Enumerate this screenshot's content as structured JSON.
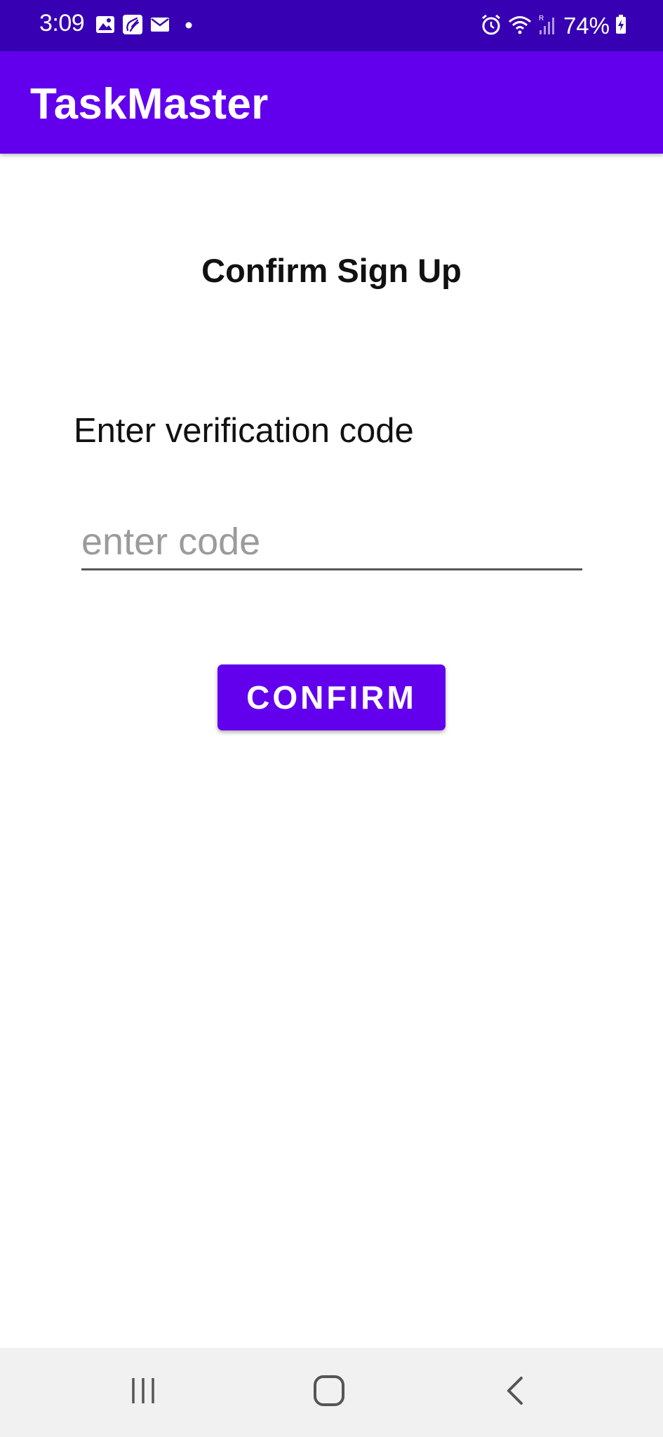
{
  "status_bar": {
    "time": "3:09",
    "battery_percent": "74%",
    "left_icons": [
      "gallery-icon",
      "sign-language-icon",
      "email-icon",
      "dot-icon"
    ],
    "right_icons": [
      "alarm-icon",
      "wifi-icon",
      "signal-icon",
      "battery-icon"
    ]
  },
  "app_bar": {
    "title": "TaskMaster"
  },
  "main": {
    "heading": "Confirm Sign Up",
    "field_label": "Enter verification code",
    "code_input": {
      "placeholder": "enter code",
      "value": ""
    },
    "confirm_label": "CONFIRM"
  },
  "nav_bar": {
    "buttons": [
      "recents-icon",
      "home-icon",
      "back-icon"
    ]
  },
  "colors": {
    "primary": "#6200ee",
    "primary_dark": "#3700b3",
    "background": "#ffffff",
    "nav_bar": "#f1f1f1"
  }
}
